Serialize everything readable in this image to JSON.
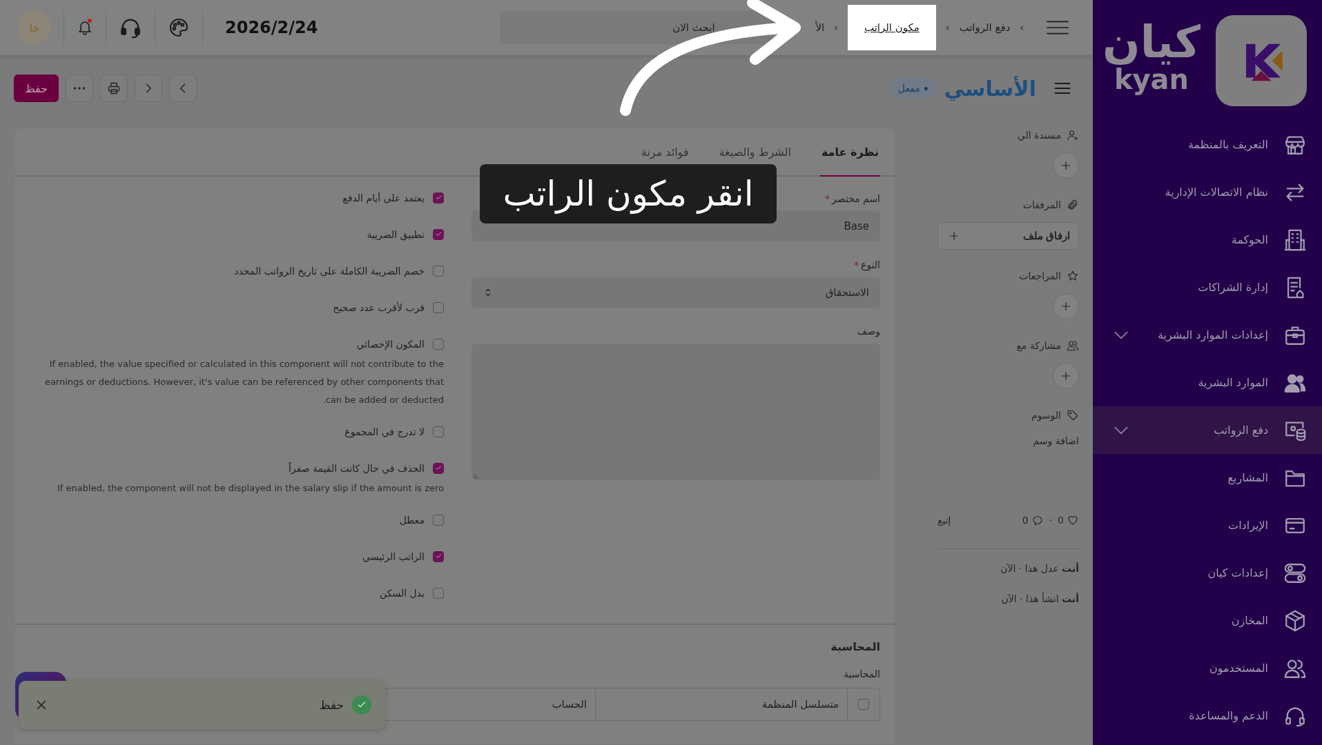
{
  "sidebar": {
    "logo": {
      "name_ar": "كيان",
      "name_en": "kyan"
    },
    "items": [
      {
        "label": "التعريف بالمنظمة",
        "kind": "link",
        "selected": false
      },
      {
        "label": "نظام الاتصالات الإدارية",
        "kind": "link",
        "selected": false
      },
      {
        "label": "الحوكمة",
        "kind": "link",
        "selected": false
      },
      {
        "label": "إدارة الشراكات",
        "kind": "link",
        "selected": false
      },
      {
        "label": "إعدادات الموارد البشرية",
        "kind": "group",
        "selected": false
      },
      {
        "label": "الموارد البشرية",
        "kind": "link",
        "selected": false
      },
      {
        "label": "دفع الرواتب",
        "kind": "group",
        "selected": true
      },
      {
        "label": "المشاريع",
        "kind": "link",
        "selected": false
      },
      {
        "label": "الإيرادات",
        "kind": "link",
        "selected": false
      },
      {
        "label": "إعدادات كيان",
        "kind": "link",
        "selected": false
      },
      {
        "label": "المخازن",
        "kind": "link",
        "selected": false
      },
      {
        "label": "المستخدمون",
        "kind": "link",
        "selected": false
      },
      {
        "label": "الدعم والمساعدة",
        "kind": "link",
        "selected": false
      }
    ]
  },
  "topbar": {
    "breadcrumbs": [
      {
        "label": "دفع الرواتب",
        "highlighted": false
      },
      {
        "label": "مكون الراتب",
        "highlighted": true
      },
      {
        "label": "الأ",
        "highlighted": false
      }
    ],
    "separator": "›",
    "search": {
      "placeholder": "ابحث الان"
    },
    "date": "2026/2/24",
    "unread_notifications": true,
    "avatar": "خا"
  },
  "toolbar": {
    "title": "الأساسي",
    "status": "مفعل",
    "save_label": "حفظ"
  },
  "tabs": [
    {
      "label": "نظرة عامة",
      "selected": true
    },
    {
      "label": "الشرط والصيغة",
      "selected": false
    },
    {
      "label": "فوائد مرنة",
      "selected": false
    }
  ],
  "form": {
    "required_mark": "*",
    "fields": [
      {
        "kind": "text",
        "label": "اسم مختصر",
        "required": true,
        "value": "Base"
      },
      {
        "kind": "select",
        "label": "النوع",
        "required": true,
        "value": "الاستحقاق"
      },
      {
        "kind": "textarea",
        "label": "وصف",
        "required": false
      }
    ]
  },
  "options": [
    {
      "label": "يعتمد على أيام الدفع",
      "checked": true
    },
    {
      "label": "تطبيق الضريبة",
      "checked": true
    },
    {
      "label": "خصم الضريبة الكاملة على تاريخ الرواتب المحدد",
      "checked": false
    },
    {
      "label": "قرب لأقرب عدد صحيح",
      "checked": false
    },
    {
      "label": "المكون الإحصائي",
      "checked": false,
      "note": "If enabled, the value specified or calculated in this component will not contribute to the earnings or deductions. However, it's value can be referenced by other components that can be added or deducted."
    },
    {
      "label": "لا تدرج في المجموع",
      "checked": false
    },
    {
      "label": "الحذف في حال كانت القيمة صفراً",
      "checked": true,
      "note": "If enabled, the component will not be displayed in the salary slip if the amount is zero"
    },
    {
      "label": "معطل",
      "checked": false
    },
    {
      "label": "الراتب الرئيسي",
      "checked": true
    },
    {
      "label": "بدل السكن",
      "checked": false
    }
  ],
  "accounting": {
    "title": "المحاسبة",
    "label": "المحاسبة",
    "select_all_checked": false,
    "columns": [
      "متسلسل المنظمة",
      "الحساب"
    ]
  },
  "side_panel": {
    "assigned_to": "مسندة الي",
    "attachments": "المرفقات",
    "attach_button": "ارفاق ملف",
    "reviews": "المراجعات",
    "shared_with": "مشاركة مع",
    "tags": "الوسوم",
    "add_tag": "اضافة وسم",
    "likes": "0",
    "separator": "·",
    "comments": "0",
    "follow": "إتبع",
    "activity": [
      "**أنت** عدل هذا · الآن",
      "**أنت** انشأ هذا · الآن"
    ]
  },
  "tutorial": {
    "tooltip": "انقر مكون الراتب"
  },
  "toast": {
    "message": "حفظ"
  }
}
